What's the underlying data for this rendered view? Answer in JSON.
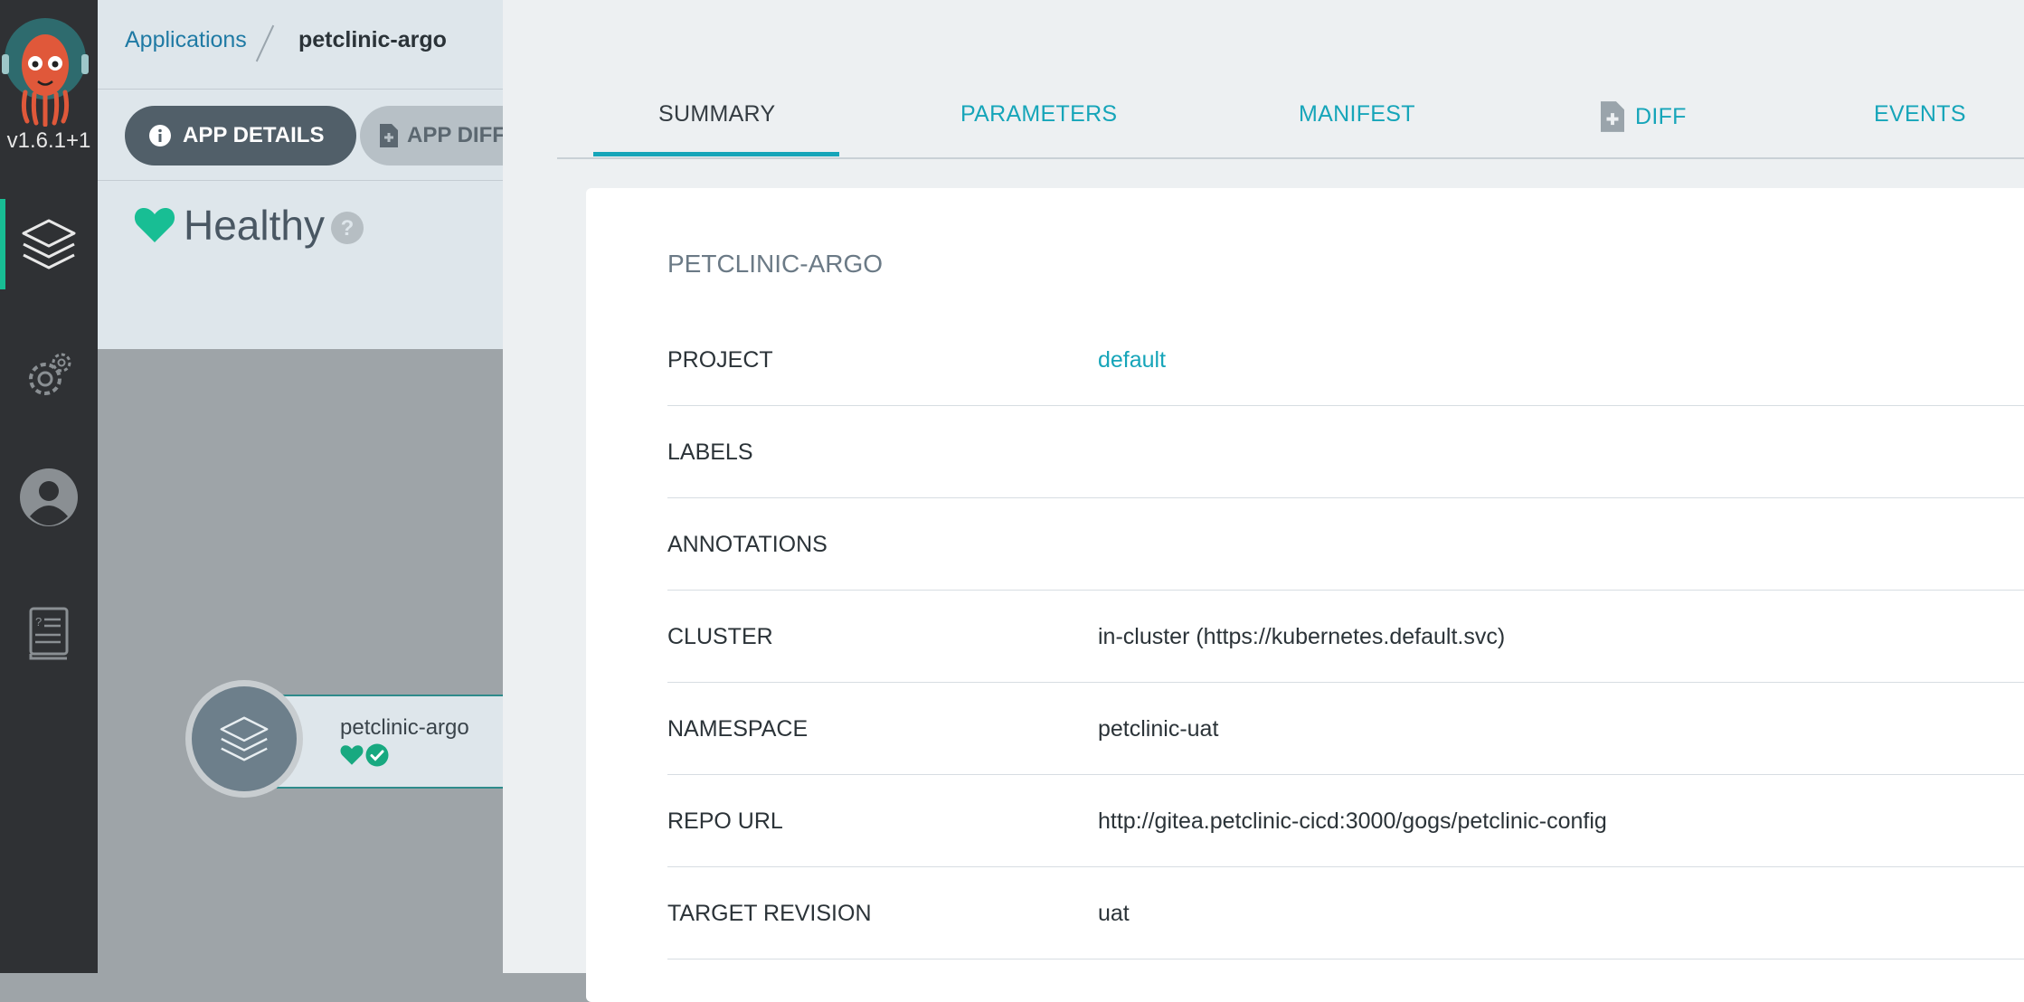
{
  "nav": {
    "version": "v1.6.1+1",
    "items": [
      "applications",
      "settings",
      "user-info",
      "documentation"
    ]
  },
  "breadcrumb": {
    "applications": "Applications",
    "app": "petclinic-argo"
  },
  "toolbar": {
    "app_details": "APP DETAILS",
    "app_diff": "APP DIFF"
  },
  "status": {
    "health": "Healthy"
  },
  "graph": {
    "node_name": "petclinic-argo"
  },
  "panel": {
    "tabs": [
      {
        "label": "SUMMARY"
      },
      {
        "label": "PARAMETERS"
      },
      {
        "label": "MANIFEST"
      },
      {
        "label": "DIFF"
      },
      {
        "label": "EVENTS"
      }
    ],
    "active_tab": "SUMMARY",
    "title": "PETCLINIC-ARGO",
    "rows": [
      {
        "label": "PROJECT",
        "value": "default"
      },
      {
        "label": "LABELS",
        "value": ""
      },
      {
        "label": "ANNOTATIONS",
        "value": ""
      },
      {
        "label": "CLUSTER",
        "value": "in-cluster (https://kubernetes.default.svc)"
      },
      {
        "label": "NAMESPACE",
        "value": "petclinic-uat"
      },
      {
        "label": "REPO URL",
        "value": "http://gitea.petclinic-cicd:3000/gogs/petclinic-config"
      },
      {
        "label": "TARGET REVISION",
        "value": "uat"
      }
    ]
  },
  "colors": {
    "accent": "#16a5b9",
    "healthy": "#18be94",
    "nav_bg": "#2f3134"
  }
}
